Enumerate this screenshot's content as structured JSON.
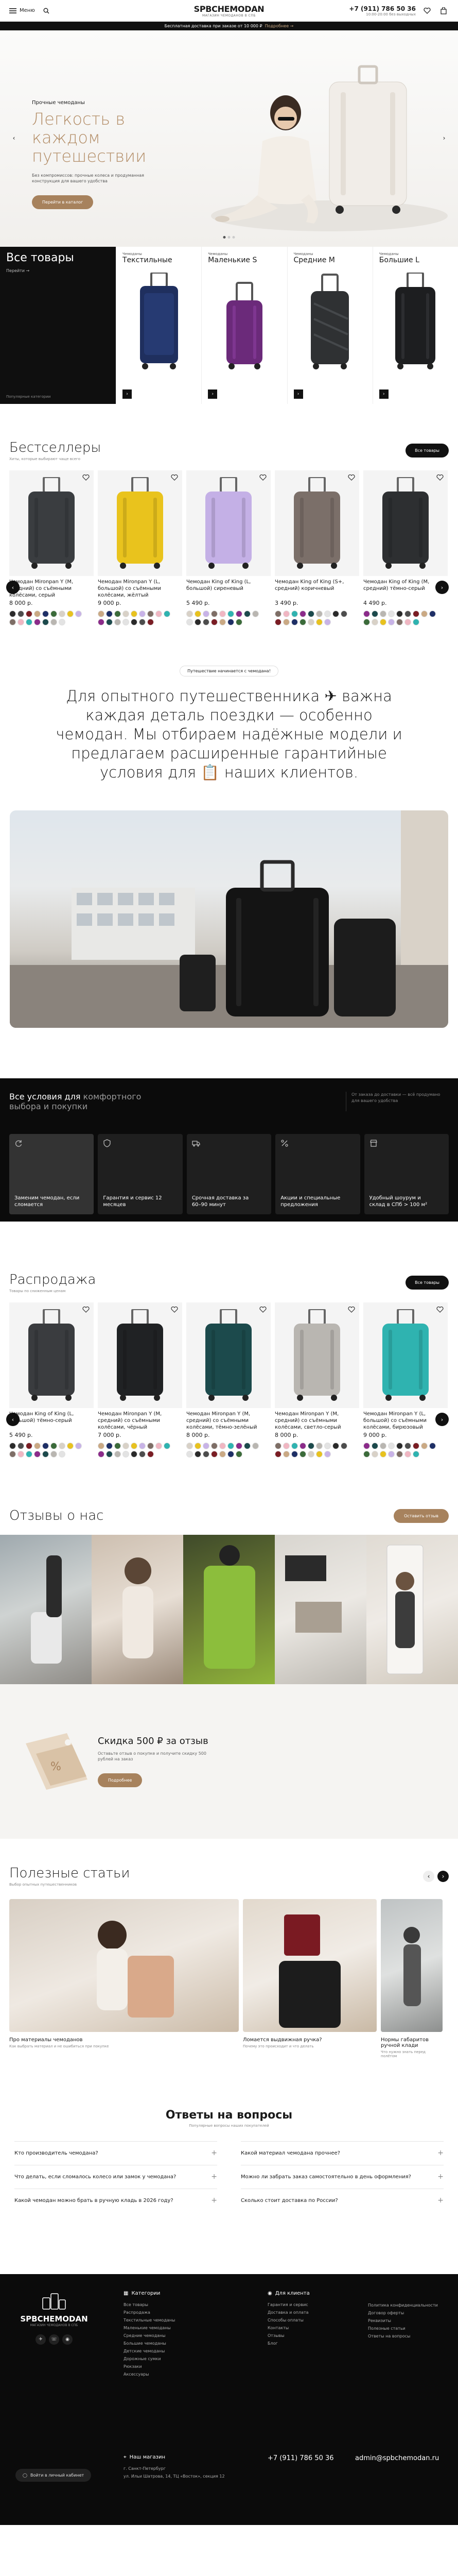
{
  "header": {
    "menu_label": "Меню",
    "logo_title": "SPBCHEMODAN",
    "logo_sub": "МАГАЗИН ЧЕМОДАНОВ В СПБ",
    "phone": "+7 (911) 786 50 36",
    "hours": "10:00-20:00 без выходных",
    "announcement": "Бесплатная доставка при заказе от 10 000 ₽",
    "announcement_link": "Подробнее →"
  },
  "hero": {
    "sub": "Прочные чемоданы",
    "title": "Легкость в каждом путешествии",
    "desc": "Без компромиссов: прочные колеса и продуманная конструкция для вашего удобства",
    "button": "Перейти в каталог"
  },
  "categories": {
    "all_title": "Все товары",
    "all_link": "Перейти →",
    "all_bottom": "Популярные категории",
    "items": [
      {
        "sub": "Чемоданы",
        "name": "Текстильные"
      },
      {
        "sub": "Чемоданы",
        "name": "Маленькие S"
      },
      {
        "sub": "Чемоданы",
        "name": "Средние M"
      },
      {
        "sub": "Чемоданы",
        "name": "Большие L"
      }
    ]
  },
  "bestsellers": {
    "title": "Бестселлеры",
    "sub": "Хиты, которые выбирают чаще всего",
    "button": "Все товары",
    "items": [
      {
        "name": "Чемодан Mironpan Y (M, средний) со съёмными колёсами, серый",
        "price": "8 000 р.",
        "color": "#3a3d40"
      },
      {
        "name": "Чемодан Mironpan Y (L, большой) со съёмными колёсами, жёлтый",
        "price": "9 000 р.",
        "color": "#e9c31d"
      },
      {
        "name": "Чемодан King of King (L, большой) сиреневый",
        "price": "5 490 р.",
        "color": "#c4b0e6"
      },
      {
        "name": "Чемодан King of King (S+, средний) коричневый",
        "price": "3 490 р.",
        "color": "#7b6f69"
      },
      {
        "name": "Чемодан King of King (M, средний) тёмно-серый",
        "price": "4 490 р.",
        "color": "#2d2f31"
      }
    ]
  },
  "manifesto": {
    "pill": "Путешествие начинается с чемодана!",
    "text": "Для опытного путешественника ✈ важна каждая деталь поездки — особенно чемодан. Мы отбираем надёжные модели и предлагаем расширенные гарантийные условия для 📋 наших клиентов."
  },
  "conditions": {
    "title_a": "Все условия для",
    "title_b": "комфортного выбора и покупки",
    "note": "От заказа до доставки — всё продумано для вашего удобства",
    "cards": [
      "Заменим чемодан, если сломается",
      "Гарантия и сервис 12 месяцев",
      "Срочная доставка за 60–90 минут",
      "Акции и специальные предложения",
      "Удобный шоурум и склад в СПб > 100 м²"
    ]
  },
  "sale": {
    "title": "Распродажа",
    "sub": "Товары по сниженным ценам",
    "button": "Все товары",
    "items": [
      {
        "name": "Чемодан King of King (L, большой) тёмно-серый",
        "price": "5 490 р.",
        "color": "#3a3c3f"
      },
      {
        "name": "Чемодан Mironpan Y (M, средний) со съёмными колёсами, чёрный",
        "price": "7 000 р.",
        "color": "#202224"
      },
      {
        "name": "Чемодан Mironpan Y (M, средний) со съёмными колёсами, тёмно-зелёный",
        "price": "8 000 р.",
        "color": "#1c4a4c"
      },
      {
        "name": "Чемодан Mironpan Y (M, средний) со съёмными колёсами, светло-серый",
        "price": "8 000 р.",
        "color": "#b9b6b1"
      },
      {
        "name": "Чемодан Mironpan Y (L, большой) со съёмными колёсами, бирюзовый",
        "price": "9 000 р.",
        "color": "#2fb3b0"
      }
    ]
  },
  "reviews": {
    "title": "Отзывы о нас",
    "button": "Оставить отзыв"
  },
  "discount": {
    "title": "Скидка 500 ₽ за отзыв",
    "desc": "Оставьте отзыв о покупке и получите скидку 500 рублей на заказ",
    "button": "Подробнее"
  },
  "articles": {
    "title": "Полезные статьи",
    "sub": "Выбор опытных путешественников",
    "items": [
      {
        "title": "Про материалы чемоданов",
        "desc": "Как выбрать материал и не ошибиться при покупке"
      },
      {
        "title": "Ломается выдвижная ручка?",
        "desc": "Почему это происходит и что делать"
      },
      {
        "title": "Нормы габаритов ручной клади",
        "desc": "Что нужно знать перед полётом"
      }
    ]
  },
  "faq": {
    "title": "Ответы на вопросы",
    "sub": "Популярные вопросы наших покупателей",
    "left": [
      "Кто производитель чемодана?",
      "Что делать, если сломалось колесо или замок у чемодана?",
      "Какой чемодан можно брать в ручную кладь в 2026 году?"
    ],
    "right": [
      "Какой материал чемодана прочнее?",
      "Можно ли забрать заказ самостоятельно в день оформления?",
      "Сколько стоит доставка по России?"
    ]
  },
  "footer": {
    "catalog_title": "Категории",
    "catalog": [
      "Все товары",
      "Распродажа",
      "Текстильные чемоданы",
      "Маленькие чемоданы",
      "Средние чемоданы",
      "Большие чемоданы",
      "Детские чемоданы",
      "Дорожные сумки",
      "Рюкзаки",
      "Аксессуары"
    ],
    "client_title": "Для клиента",
    "client_a": [
      "Гарантия и сервис",
      "Доставка и оплата",
      "Способы оплаты",
      "Контакты",
      "Отзывы",
      "Блог"
    ],
    "client_b": [
      "Политика конфиденциальности",
      "Договор оферты",
      "Реквизиты",
      "Полезные статьи",
      "Ответы на вопросы"
    ],
    "store_title": "Наш магазин",
    "address": "г. Санкт-Петербург",
    "address2": "ул. Ильи Шатрова, 14, ТЦ «Восток», секция 12",
    "phone": "+7 (911) 786 50 36",
    "email": "admin@spbchemodan.ru",
    "login": "Войти в личный кабинет"
  }
}
